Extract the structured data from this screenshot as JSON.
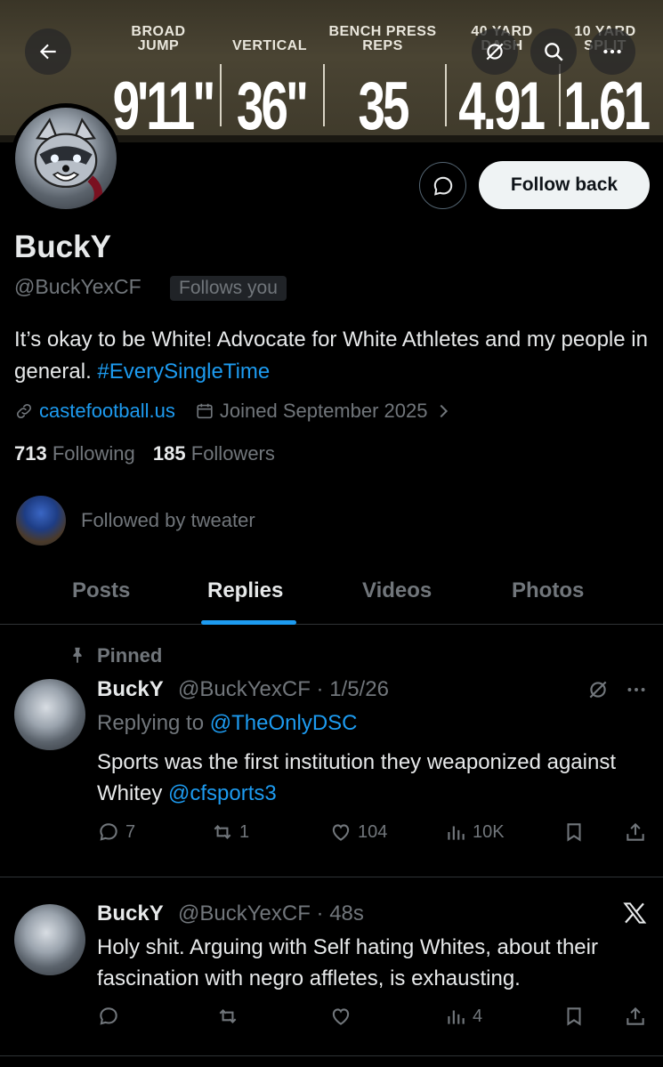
{
  "banner": {
    "stats": [
      {
        "label": "BROAD JUMP",
        "value": "9'11\""
      },
      {
        "label": "VERTICAL",
        "value": "36\""
      },
      {
        "label": "BENCH PRESS REPS",
        "value": "35"
      },
      {
        "label": "40 YARD DASH",
        "value": "4.91"
      },
      {
        "label": "10 YARD SPLIT",
        "value": "1.61"
      }
    ]
  },
  "profile": {
    "display_name": "BuckY",
    "handle": "@BuckYexCF",
    "follows_you": "Follows you",
    "follow_button": "Follow back",
    "bio_text": "It’s okay to be White! Advocate for White Athletes and my people in general. ",
    "bio_hashtag": "#EverySingleTime",
    "website": "castefootball.us",
    "joined": "Joined September 2025",
    "following_count": "713",
    "following_label": "Following",
    "followers_count": "185",
    "followers_label": "Followers",
    "followed_by": "Followed by tweater"
  },
  "tabs": [
    "Posts",
    "Replies",
    "Videos",
    "Photos"
  ],
  "posts": [
    {
      "pinned_label": "Pinned",
      "name": "BuckY",
      "handle_time": "@BuckYexCF · 1/5/26",
      "replying_prefix": "Replying to ",
      "replying_to": "@TheOnlyDSC",
      "text": "Sports was the first institution they weaponized against Whitey ",
      "mention": "@cfsports3",
      "replies": "7",
      "reposts": "1",
      "likes": "104",
      "views": "10K"
    },
    {
      "name": "BuckY",
      "handle_time": "@BuckYexCF · 48s",
      "text": "Holy shit. Arguing with Self hating Whites, about their fascination with negro affletes, is exhausting.",
      "views": "4"
    }
  ],
  "colors": {
    "accent": "#1d9bf0",
    "muted": "#71767b",
    "text": "#e7e9ea",
    "background": "#000000"
  }
}
